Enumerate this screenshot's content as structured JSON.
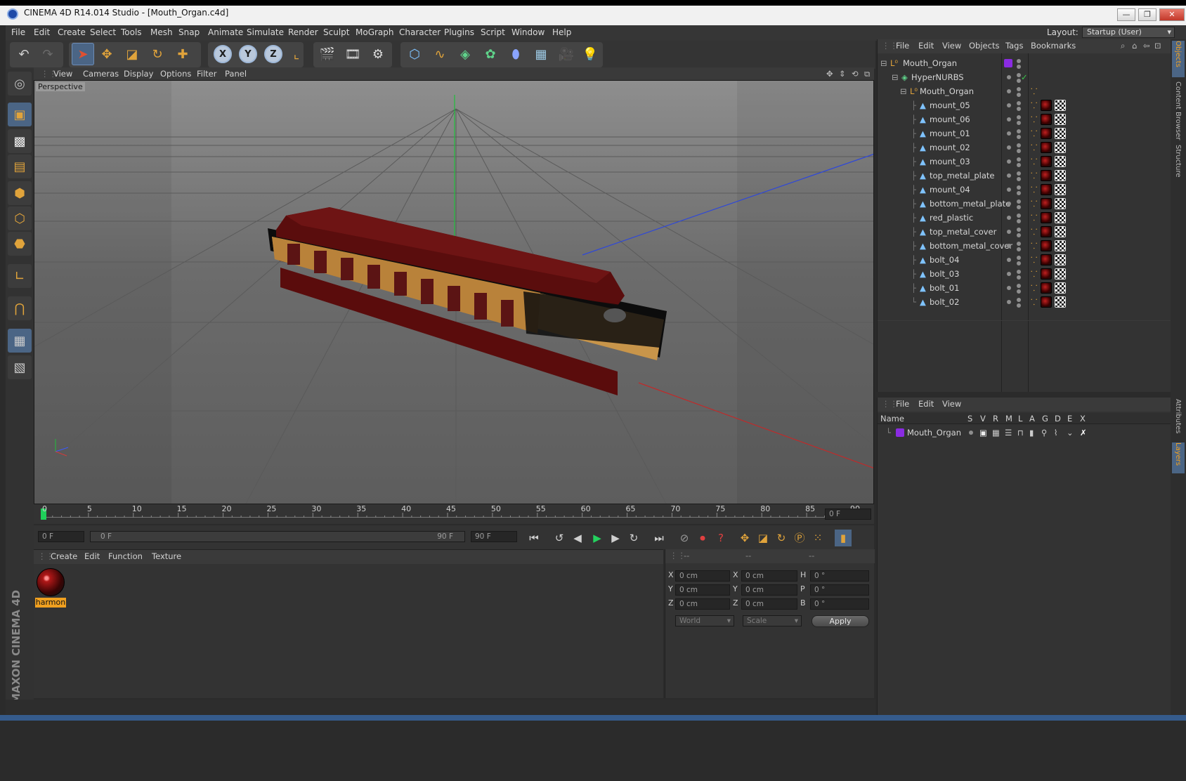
{
  "window": {
    "title": "CINEMA 4D R14.014 Studio - [Mouth_Organ.c4d]",
    "min": "—",
    "max": "❐",
    "close": "✕"
  },
  "menubar": {
    "items": [
      "File",
      "Edit",
      "Create",
      "Select",
      "Tools",
      "Mesh",
      "Snap",
      "Animate",
      "Simulate",
      "Render",
      "Sculpt",
      "MoGraph",
      "Character",
      "Plugins",
      "Script",
      "Window",
      "Help"
    ],
    "layout_label": "Layout:",
    "layout_value": "Startup (User)"
  },
  "viewport": {
    "menu": [
      "View",
      "Cameras",
      "Display",
      "Options",
      "Filter",
      "Panel"
    ],
    "label": "Perspective"
  },
  "timeline": {
    "ticks": [
      "0",
      "5",
      "10",
      "15",
      "20",
      "25",
      "30",
      "35",
      "40",
      "45",
      "50",
      "55",
      "60",
      "65",
      "70",
      "75",
      "80",
      "85",
      "90"
    ],
    "current_frame": "0 F",
    "start_field": "0 F",
    "range_start": "0 F",
    "range_end": "90 F",
    "end_field": "90 F"
  },
  "material_manager": {
    "menu": [
      "Create",
      "Edit",
      "Function",
      "Texture"
    ],
    "materials": [
      {
        "name": "harmon"
      }
    ]
  },
  "coordinates": {
    "headers": [
      "--",
      "--",
      "--"
    ],
    "rows": [
      {
        "a": "X",
        "av": "0 cm",
        "b": "X",
        "bv": "0 cm",
        "c": "H",
        "cv": "0 °"
      },
      {
        "a": "Y",
        "av": "0 cm",
        "b": "Y",
        "bv": "0 cm",
        "c": "P",
        "cv": "0 °"
      },
      {
        "a": "Z",
        "av": "0 cm",
        "b": "Z",
        "bv": "0 cm",
        "c": "B",
        "cv": "0 °"
      }
    ],
    "mode": "World",
    "size_mode": "Scale",
    "apply": "Apply"
  },
  "object_manager": {
    "menu": [
      "File",
      "Edit",
      "View",
      "Objects",
      "Tags",
      "Bookmarks"
    ],
    "root": "Mouth_Organ",
    "hypernurbs": "HyperNURBS",
    "group": "Mouth_Organ",
    "children": [
      "mount_05",
      "mount_06",
      "mount_01",
      "mount_02",
      "mount_03",
      "top_metal_plate",
      "mount_04",
      "bottom_metal_plate",
      "red_plastic",
      "top_metal_cover",
      "bottom_metal_cover",
      "bolt_04",
      "bolt_03",
      "bolt_01",
      "bolt_02"
    ],
    "check": "✓"
  },
  "layer_manager": {
    "menu": [
      "File",
      "Edit",
      "View"
    ],
    "columns": [
      "Name",
      "S",
      "V",
      "R",
      "M",
      "L",
      "A",
      "G",
      "D",
      "E",
      "X"
    ],
    "layers": [
      {
        "name": "Mouth_Organ"
      }
    ]
  },
  "right_tabs": [
    "Objects",
    "Content Browser",
    "Structure",
    "Attributes",
    "Layers"
  ],
  "brand": "MAXON CINEMA 4D",
  "colors": {
    "accent": "#4b6585",
    "orange": "#e0a33b",
    "layer_purple": "#8a2be2"
  }
}
